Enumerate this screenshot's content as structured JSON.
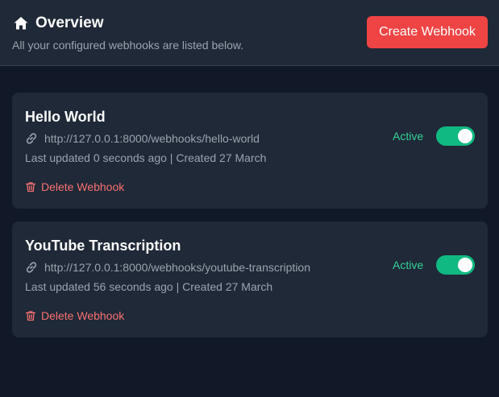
{
  "header": {
    "title": "Overview",
    "subtitle": "All your configured webhooks are listed below.",
    "create_button_label": "Create Webhook"
  },
  "webhooks": [
    {
      "name": "Hello World",
      "url": "http://127.0.0.1:8000/webhooks/hello-world",
      "meta": "Last updated 0 seconds ago | Created 27 March",
      "status": "Active",
      "enabled": true,
      "delete_label": "Delete Webhook"
    },
    {
      "name": "YouTube Transcription",
      "url": "http://127.0.0.1:8000/webhooks/youtube-transcription",
      "meta": "Last updated 56 seconds ago | Created 27 March",
      "status": "Active",
      "enabled": true,
      "delete_label": "Delete Webhook"
    }
  ],
  "icons": {
    "title": "home-icon",
    "url": "link-icon",
    "delete": "trash-icon"
  },
  "colors": {
    "accent": "#ef4444",
    "active": "#10b981",
    "background": "#111827",
    "card": "#1f2937"
  }
}
